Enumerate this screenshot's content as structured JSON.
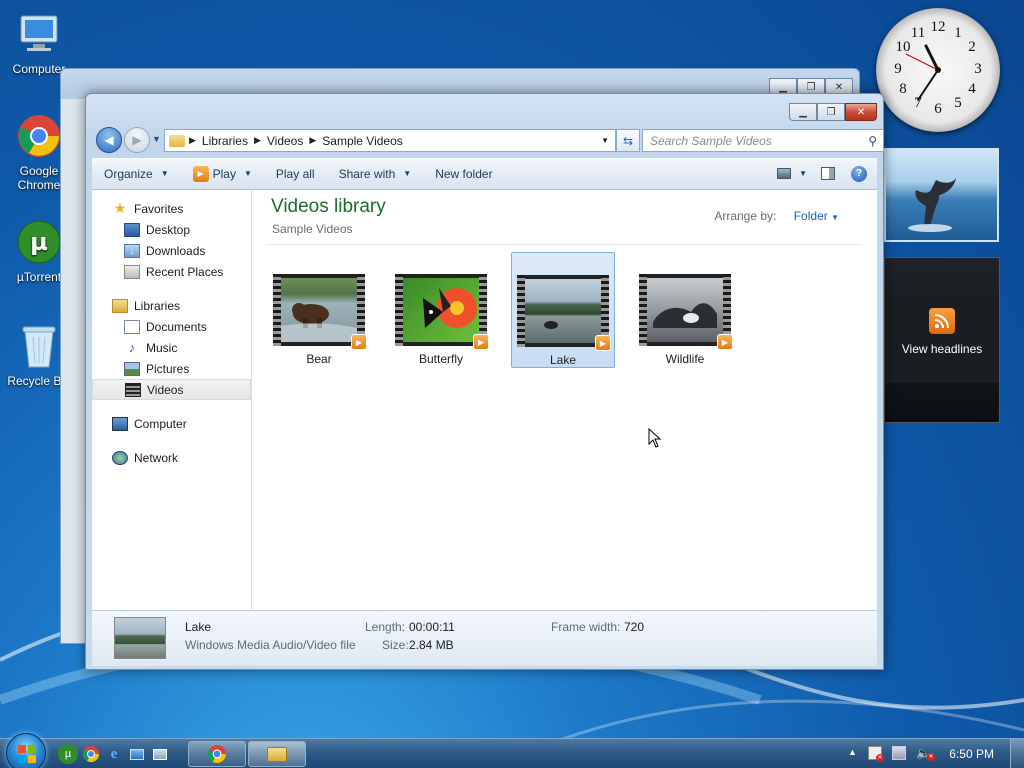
{
  "desktop": {
    "icons": [
      {
        "label": "Computer",
        "icon": "computer-icon"
      },
      {
        "label": "Google\nChrome",
        "icon": "chrome-icon"
      },
      {
        "label": "µTorrent",
        "icon": "utorrent-icon"
      },
      {
        "label": "Recycle Bin",
        "icon": "recycle-bin-icon"
      }
    ]
  },
  "gadgets": {
    "clock": {
      "numbers": [
        "12",
        "1",
        "2",
        "3",
        "4",
        "5",
        "6",
        "7",
        "8",
        "9",
        "10",
        "11"
      ]
    },
    "rss": {
      "label": "View headlines"
    }
  },
  "window": {
    "breadcrumb": [
      "Libraries",
      "Videos",
      "Sample Videos"
    ],
    "search_placeholder": "Search Sample Videos",
    "toolbar": {
      "organize": "Organize",
      "play": "Play",
      "play_all": "Play all",
      "share_with": "Share with",
      "new_folder": "New folder"
    },
    "nav": {
      "favorites": "Favorites",
      "favorites_items": [
        "Desktop",
        "Downloads",
        "Recent Places"
      ],
      "libraries": "Libraries",
      "libraries_items": [
        "Documents",
        "Music",
        "Pictures",
        "Videos"
      ],
      "computer": "Computer",
      "network": "Network"
    },
    "library": {
      "title": "Videos library",
      "subtitle": "Sample Videos",
      "arrange_by_label": "Arrange by:",
      "arrange_by_value": "Folder"
    },
    "files": [
      {
        "name": "Bear",
        "selected": false
      },
      {
        "name": "Butterfly",
        "selected": false
      },
      {
        "name": "Lake",
        "selected": true
      },
      {
        "name": "Wildlife",
        "selected": false
      }
    ],
    "details": {
      "name": "Lake",
      "type": "Windows Media Audio/Video file",
      "length_label": "Length:",
      "length_value": "00:00:11",
      "size_label": "Size:",
      "size_value": "2.84 MB",
      "frame_width_label": "Frame width:",
      "frame_width_value": "720"
    }
  },
  "taskbar": {
    "time": "6:50 PM"
  },
  "colors": {
    "library_title": "#1e6c2c",
    "link_blue": "#1e62b8",
    "selection": "#c7dcf5"
  }
}
